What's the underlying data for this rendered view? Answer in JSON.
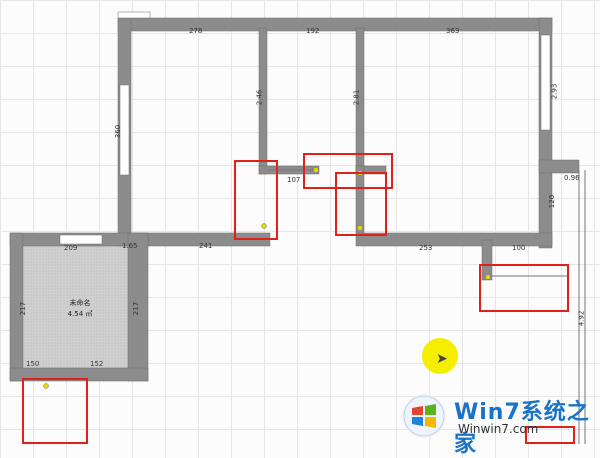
{
  "dims": {
    "top_278": "278",
    "top_192": "192",
    "top_363": "363",
    "left_room1_v": "360",
    "inner_v1": "2.46",
    "inner_v2": "2.81",
    "right_v": "2.93",
    "door_107": "107",
    "bottom_241": "241",
    "bottom_253": "253",
    "bottom_100": "100",
    "bottom_165": "1.65",
    "balcony_209": "209",
    "right_096": "0.96",
    "right_120": "120",
    "right_492": "4.92",
    "bal_left": "217",
    "bal_right": "217",
    "bal_bottom_150": "150",
    "bal_bottom_152": "152"
  },
  "room": {
    "name": "未命名",
    "area": "4.54 ㎡"
  },
  "colors": {
    "wall": "#8c8c8c",
    "wall_edge": "#6f6f6f",
    "floor_hatch": "#c8c8c8",
    "marker_red": "#e0201a",
    "cursor_yellow": "#f5ee00"
  },
  "watermark": {
    "title": "Win7系统之家",
    "url": "Winwin7.com"
  }
}
